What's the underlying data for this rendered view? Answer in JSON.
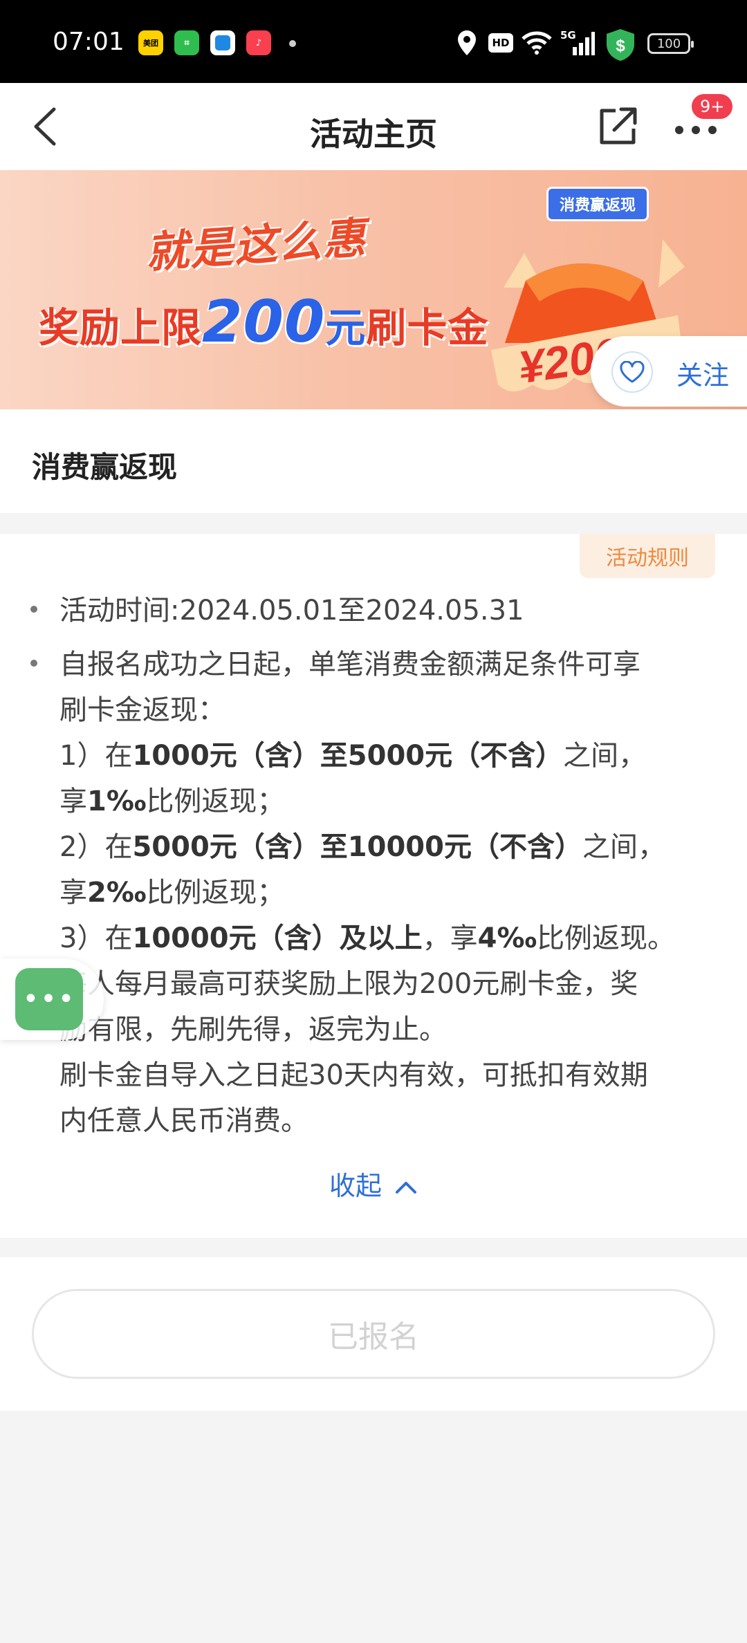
{
  "status_bar": {
    "time": "07:01",
    "apps": [
      {
        "name": "meituan",
        "text": "美团"
      },
      {
        "name": "green-app",
        "text": "⌗"
      },
      {
        "name": "blue-app",
        "text": ""
      },
      {
        "name": "music-app",
        "text": "♪"
      }
    ],
    "hd_label": "HD",
    "network_label": "5G",
    "battery": "100"
  },
  "header": {
    "title": "活动主页",
    "badge": "9+"
  },
  "banner": {
    "slogan": "就是这么惠",
    "headline_prefix": "奖励上限",
    "headline_amount": "200",
    "headline_unit": "元",
    "headline_suffix": "刷卡金",
    "tag": "消费赢返现",
    "art_amount": "¥200"
  },
  "follow": {
    "label": "关注"
  },
  "section": {
    "title": "消费赢返现"
  },
  "rules": {
    "button": "活动规则",
    "time_line": "活动时间:2024.05.01至2024.05.31",
    "intro_1": "自报名成功之日起，单笔消费金额满足条件可享",
    "intro_2": "刷卡金返现：",
    "tier1_prefix": "1）在",
    "tier1_bold": "1000元（含）至5000元（不含）",
    "tier1_suffix": "之间，",
    "tier1_rate_prefix": "享",
    "tier1_rate": "1‰",
    "tier1_rate_suffix": "比例返现；",
    "tier2_prefix": "2）在",
    "tier2_bold": "5000元（含）至10000元（不含）",
    "tier2_suffix": "之间，",
    "tier2_rate_prefix": "享",
    "tier2_rate": "2‰",
    "tier2_rate_suffix": "比例返现；",
    "tier3_prefix": "3）在",
    "tier3_bold": "10000元（含）及以上",
    "tier3_mid": "，享",
    "tier3_rate": "4‰",
    "tier3_suffix": "比例返现。",
    "limit_1": "每人每月最高可获奖励上限为200元刷卡金，奖",
    "limit_2": "励有限，先刷先得，返完为止。",
    "validity_1": "刷卡金自导入之日起30天内有效，可抵扣有效期",
    "validity_2": "内任意人民币消费。",
    "collapse": "收起"
  },
  "float_chat": {
    "icon": "•••"
  },
  "signup": {
    "label": "已报名"
  }
}
